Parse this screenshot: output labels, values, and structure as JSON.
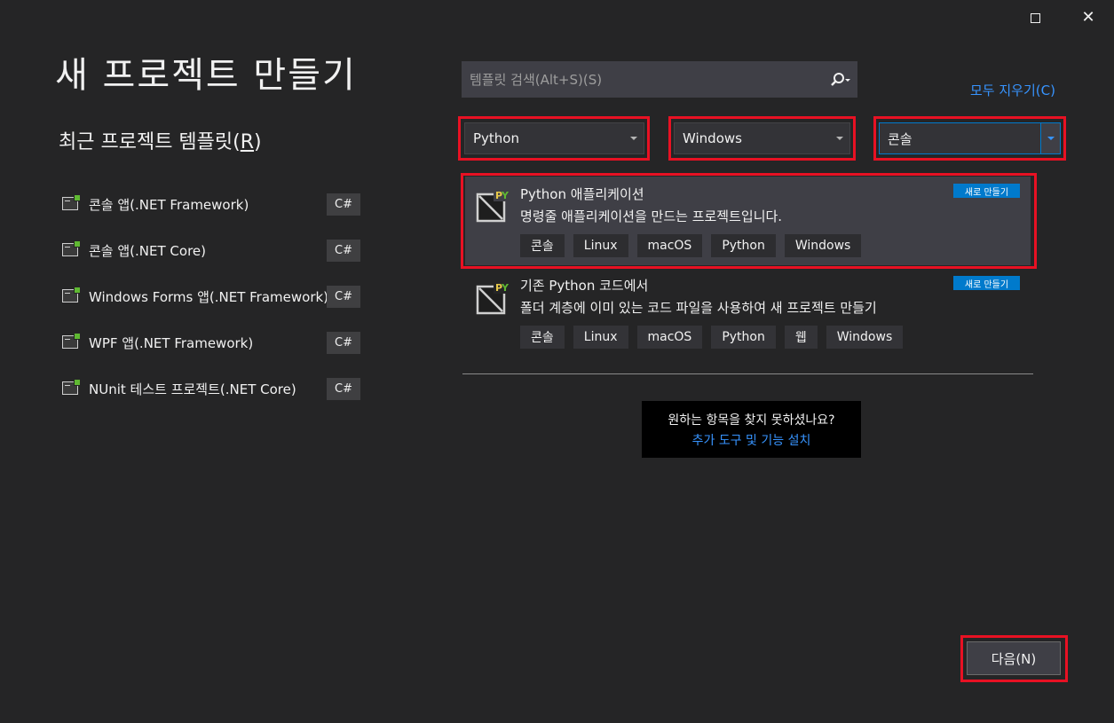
{
  "window": {
    "maximize_icon": "maximize-icon",
    "close_icon": "close-icon",
    "close_glyph": "✕"
  },
  "page_title": "새 프로젝트 만들기",
  "recent": {
    "heading_text": "최근 프로젝트 템플릿(",
    "heading_mnemonic": "R",
    "heading_close": ")",
    "items": [
      {
        "label": "콘솔 앱(.NET Framework)",
        "lang": "C#",
        "icon": "console-app-icon"
      },
      {
        "label": "콘솔 앱(.NET Core)",
        "lang": "C#",
        "icon": "console-app-icon"
      },
      {
        "label": "Windows Forms 앱(.NET Framework)",
        "lang": "C#",
        "icon": "winforms-icon"
      },
      {
        "label": "WPF 앱(.NET Framework)",
        "lang": "C#",
        "icon": "wpf-icon"
      },
      {
        "label": "NUnit 테스트 프로젝트(.NET Core)",
        "lang": "C#",
        "icon": "nunit-icon"
      }
    ]
  },
  "search": {
    "placeholder": "템플릿 검색(Alt+S)(S)",
    "icon": "search-icon"
  },
  "clear_all": "모두 지우기(C)",
  "filters": {
    "language": "Python",
    "platform": "Windows",
    "project_type": "콘솔"
  },
  "templates": [
    {
      "title": "Python 애플리케이션",
      "description": "명령줄 애플리케이션을 만드는 프로젝트입니다.",
      "badge": "새로 만들기",
      "tags": [
        "콘솔",
        "Linux",
        "macOS",
        "Python",
        "Windows"
      ],
      "selected": true
    },
    {
      "title": "기존 Python 코드에서",
      "description": "폴더 계층에 이미 있는 코드 파일을 사용하여 새 프로젝트 만들기",
      "badge": "새로 만들기",
      "tags": [
        "콘솔",
        "Linux",
        "macOS",
        "Python",
        "웹",
        "Windows"
      ],
      "selected": false
    }
  ],
  "not_found": {
    "question": "원하는 항목을 찾지 못하셨나요?",
    "link": "추가 도구 및 기능 설치"
  },
  "next_button": "다음(N)",
  "colors": {
    "background": "#252526",
    "highlight": "#e81123",
    "accent": "#007acc",
    "link": "#3794ff"
  }
}
